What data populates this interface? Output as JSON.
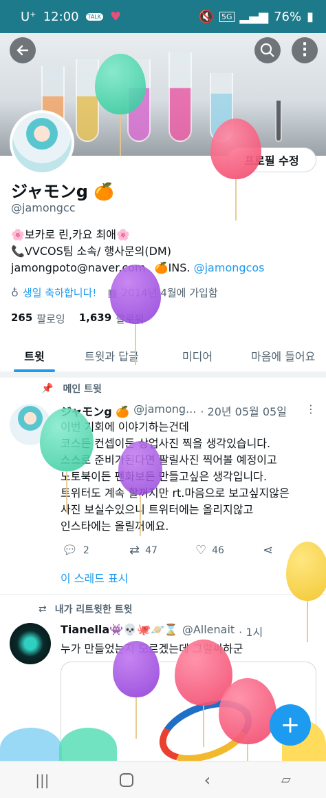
{
  "status_bar": {
    "carrier": "U⁺",
    "time": "12:00",
    "talk_badge": "TALK",
    "battery": "76%",
    "network": "5G"
  },
  "profile": {
    "edit_label": "프로필 수정",
    "name": "ジャモンg 🍊",
    "handle": "@jamongcc",
    "bio_lines": [
      "🌸보카로 린,카요 최애🌸",
      "📞VVCOS팀 소속/ 행사문의(DM)"
    ],
    "email": "jamongpoto@naver.com",
    "ins_prefix": "🍊INS.",
    "ins_handle": "@jamongcos",
    "birthday": "생일 축하합니다!",
    "joined": "2014년 4월에 가입함",
    "following_count": "265",
    "following_label": "팔로잉",
    "followers_count": "1,639",
    "followers_label": "팔로워"
  },
  "tabs": [
    {
      "label": "트윗"
    },
    {
      "label": "트윗과 답글"
    },
    {
      "label": "미디어"
    },
    {
      "label": "마음에 들어요"
    }
  ],
  "pinned": {
    "label": "메인 트윗",
    "name": "ジャモンg 🍊",
    "handle": "@jamong...",
    "date": "· 20년 05월 05일",
    "lines": [
      "이번 기회에 이야기하는건데",
      "코스든 컨셉이든 상업사진 찍을 생각있습니다.",
      "스스로 준비가된다면 팔릴사진 찍어볼 예정이고",
      "노토북이든 펜화보든 만들고싶은 생각입니다.",
      "트위터도 계속 할꺼지만 rt.마음으로 보고싶지않은",
      "사진 보실수있으니 트위터에는 올리지않고",
      "인스타에는 올릴꺼에요."
    ],
    "replies": "2",
    "retweets": "47",
    "likes": "46",
    "thread_link": "이 스레드 표시"
  },
  "retweeted": {
    "label": "내가 리트윗한 트윗",
    "name": "Tianella👾💀🐙🪐⌛",
    "handle": "@Allenait",
    "time": "· 1시",
    "text": "누가 만들었는지 모르겠는데 그럴싸하군"
  },
  "icons": [
    "back-arrow-icon",
    "search-icon",
    "more-vert-icon",
    "pin-icon",
    "retweet-icon",
    "reply-icon",
    "like-icon",
    "share-icon",
    "balloon-icon",
    "calendar-icon",
    "compose-plus-icon"
  ],
  "colors": {
    "accent": "#1d9bf0",
    "status_bar": "#1d7a8a"
  }
}
